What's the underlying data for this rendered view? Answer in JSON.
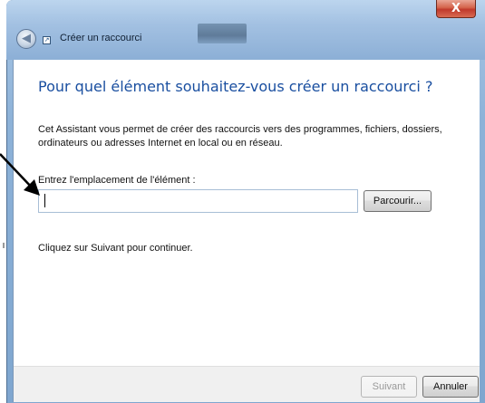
{
  "window": {
    "title": "Créer un raccourci",
    "close_label": "X"
  },
  "heading": "Pour quel élément souhaitez-vous créer un raccourci ?",
  "description": "Cet Assistant vous permet de créer des raccourcis vers des programmes, fichiers, dossiers, ordinateurs ou adresses Internet en local ou en réseau.",
  "location": {
    "label": "Entrez l'emplacement de l'élément :",
    "value": "",
    "browse_label": "Parcourir..."
  },
  "hint": "Cliquez sur Suivant pour continuer.",
  "footer": {
    "next_label": "Suivant",
    "cancel_label": "Annuler"
  },
  "icons": {
    "back": "back-arrow-icon",
    "app": "shortcut-wizard-icon",
    "pointer": "annotation-arrow-icon"
  },
  "colors": {
    "heading": "#1a4fa0",
    "close_button": "#c0392b",
    "title_bar": "#a3c1e2"
  }
}
